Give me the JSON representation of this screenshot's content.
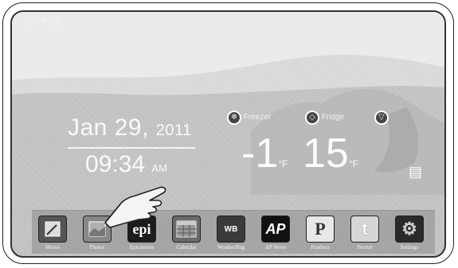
{
  "status_bar": {
    "icons": "☼ ☂ ψ"
  },
  "clock": {
    "date": "Jan 29,",
    "year": "2011",
    "time": "09:34",
    "ampm": "AM"
  },
  "temperatures": {
    "freezer_label": "Freezer",
    "fridge_label": "Fridge",
    "freezer_value": "-1",
    "freezer_unit": "°F",
    "fridge_value": "15",
    "fridge_unit": "°F"
  },
  "dock": {
    "apps": [
      {
        "label": "Memo",
        "icon": "memo-icon",
        "glyph": ""
      },
      {
        "label": "Photos",
        "icon": "photos-icon",
        "glyph": ""
      },
      {
        "label": "Epicurious",
        "icon": "epicurious-icon",
        "glyph": "epi"
      },
      {
        "label": "Calendar",
        "icon": "calendar-icon",
        "glyph": ""
      },
      {
        "label": "WeatherBug",
        "icon": "weatherbug-icon",
        "glyph": "WB"
      },
      {
        "label": "AP News",
        "icon": "ap-news-icon",
        "glyph": "AP"
      },
      {
        "label": "Pandora",
        "icon": "pandora-icon",
        "glyph": "P"
      },
      {
        "label": "Twitter",
        "icon": "twitter-icon",
        "glyph": "t"
      },
      {
        "label": "Settings",
        "icon": "settings-icon",
        "glyph": "⚙"
      }
    ]
  }
}
